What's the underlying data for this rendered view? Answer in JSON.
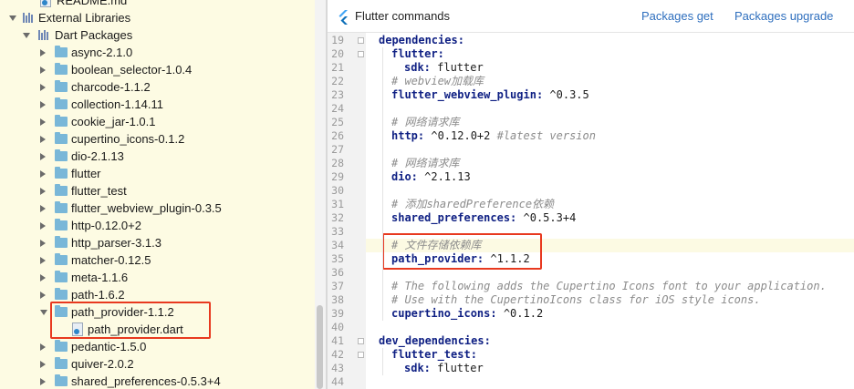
{
  "tree": {
    "partial_top": "README.md",
    "external_libraries": "External Libraries",
    "dart_packages": "Dart Packages",
    "packages": [
      "async-2.1.0",
      "boolean_selector-1.0.4",
      "charcode-1.1.2",
      "collection-1.14.11",
      "cookie_jar-1.0.1",
      "cupertino_icons-0.1.2",
      "dio-2.1.13",
      "flutter",
      "flutter_test",
      "flutter_webview_plugin-0.3.5",
      "http-0.12.0+2",
      "http_parser-3.1.3",
      "matcher-0.12.5",
      "meta-1.1.6",
      "path-1.6.2",
      "path_provider-1.1.2",
      "path_provider.dart",
      "pedantic-1.5.0",
      "quiver-2.0.2",
      "shared_preferences-0.5.3+4"
    ]
  },
  "topbar": {
    "title": "Flutter commands",
    "packages_get": "Packages get",
    "packages_upgrade": "Packages upgrade"
  },
  "editor": {
    "line_numbers": [
      "19",
      "20",
      "21",
      "22",
      "23",
      "24",
      "25",
      "26",
      "27",
      "28",
      "29",
      "30",
      "31",
      "32",
      "33",
      "34",
      "35",
      "36",
      "37",
      "38",
      "39",
      "40",
      "41",
      "42",
      "43",
      "44"
    ],
    "lines": [
      {
        "key": "dependencies:",
        "rest": "",
        "comment": ""
      },
      {
        "key": "flutter:",
        "rest": "",
        "comment": ""
      },
      {
        "key": "sdk:",
        "rest": " flutter",
        "comment": ""
      },
      {
        "key": "",
        "rest": "",
        "comment": "# webview加载库"
      },
      {
        "key": "flutter_webview_plugin:",
        "rest": " ^0.3.5",
        "comment": ""
      },
      {
        "key": "",
        "rest": "",
        "comment": ""
      },
      {
        "key": "",
        "rest": "",
        "comment": "# 网络请求库"
      },
      {
        "key": "http:",
        "rest": " ^0.12.0+2 ",
        "comment": "#latest version"
      },
      {
        "key": "",
        "rest": "",
        "comment": ""
      },
      {
        "key": "",
        "rest": "",
        "comment": "# 网络请求库"
      },
      {
        "key": "dio:",
        "rest": " ^2.1.13",
        "comment": ""
      },
      {
        "key": "",
        "rest": "",
        "comment": ""
      },
      {
        "key": "",
        "rest": "",
        "comment": "# 添加sharedPreference依赖"
      },
      {
        "key": "shared_preferences:",
        "rest": " ^0.5.3+4",
        "comment": ""
      },
      {
        "key": "",
        "rest": "",
        "comment": ""
      },
      {
        "key": "",
        "rest": "",
        "comment": "# 文件存储依赖库"
      },
      {
        "key": "path_provider:",
        "rest": " ^1.1.2",
        "comment": ""
      },
      {
        "key": "",
        "rest": "",
        "comment": ""
      },
      {
        "key": "",
        "rest": "",
        "comment": "# The following adds the Cupertino Icons font to your application."
      },
      {
        "key": "",
        "rest": "",
        "comment": "# Use with the CupertinoIcons class for iOS style icons."
      },
      {
        "key": "cupertino_icons:",
        "rest": " ^0.1.2",
        "comment": ""
      },
      {
        "key": "",
        "rest": "",
        "comment": ""
      },
      {
        "key": "dev_dependencies:",
        "rest": "",
        "comment": ""
      },
      {
        "key": "flutter_test:",
        "rest": "",
        "comment": ""
      },
      {
        "key": "sdk:",
        "rest": " flutter",
        "comment": ""
      },
      {
        "key": "",
        "rest": "",
        "comment": ""
      }
    ]
  }
}
